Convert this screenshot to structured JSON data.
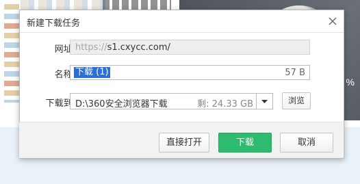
{
  "background": {
    "percent_fragment": "%"
  },
  "dialog": {
    "title": "新建下载任务",
    "close_icon": "close-icon",
    "url_label": "网址:",
    "url_prefix": "https://",
    "url_domain": "s1.cxycc.com/",
    "name_label": "名称:",
    "name_value": "下载 (1)",
    "name_size": "57 B",
    "path_label": "下载到:",
    "path_value": "D:\\360安全浏览器下载",
    "path_free": "剩: 24.33 GB",
    "path_dropdown_icon": "caret-down-icon",
    "browse_label": "浏览",
    "open_label": "直接打开",
    "download_label": "下载",
    "cancel_label": "取消"
  },
  "colors": {
    "primary_button": "#2fbb6d",
    "selection": "#2a6fd6"
  }
}
